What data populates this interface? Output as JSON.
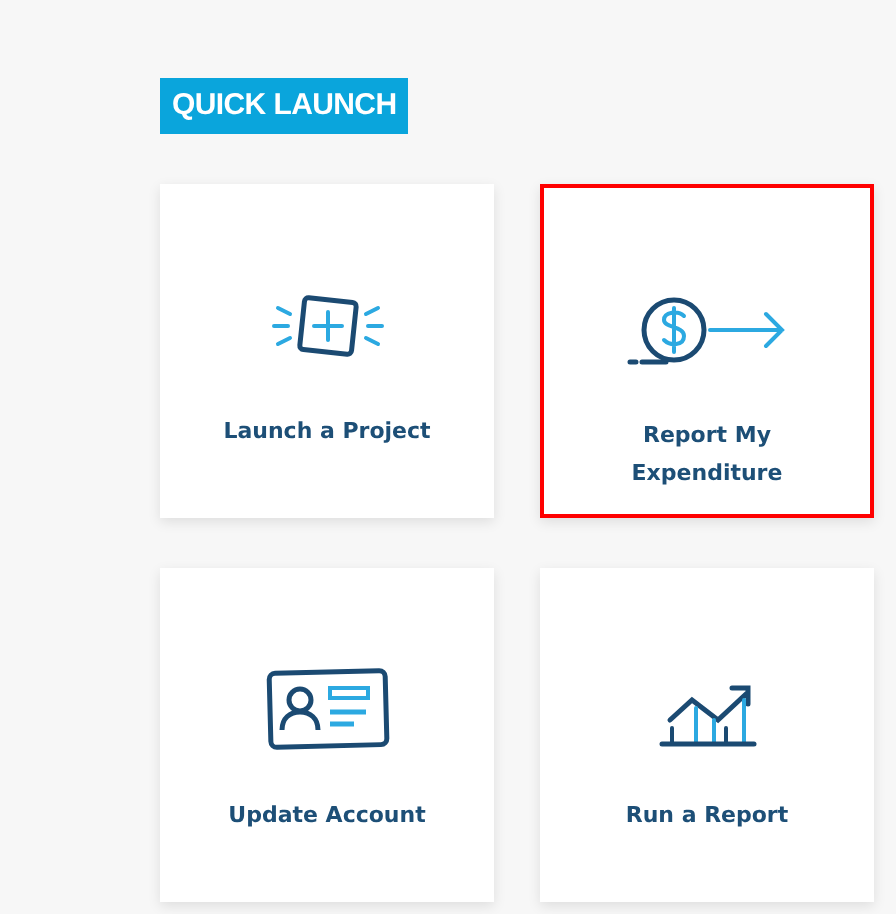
{
  "heading": "QUICK LAUNCH",
  "tiles": [
    {
      "kind": "launch",
      "label": "Launch a Project",
      "selected": false
    },
    {
      "kind": "expense",
      "label": "Report My Expenditure",
      "selected": true
    },
    {
      "kind": "account",
      "label": "Update Account",
      "selected": false
    },
    {
      "kind": "report",
      "label": "Run a Report",
      "selected": false
    }
  ]
}
